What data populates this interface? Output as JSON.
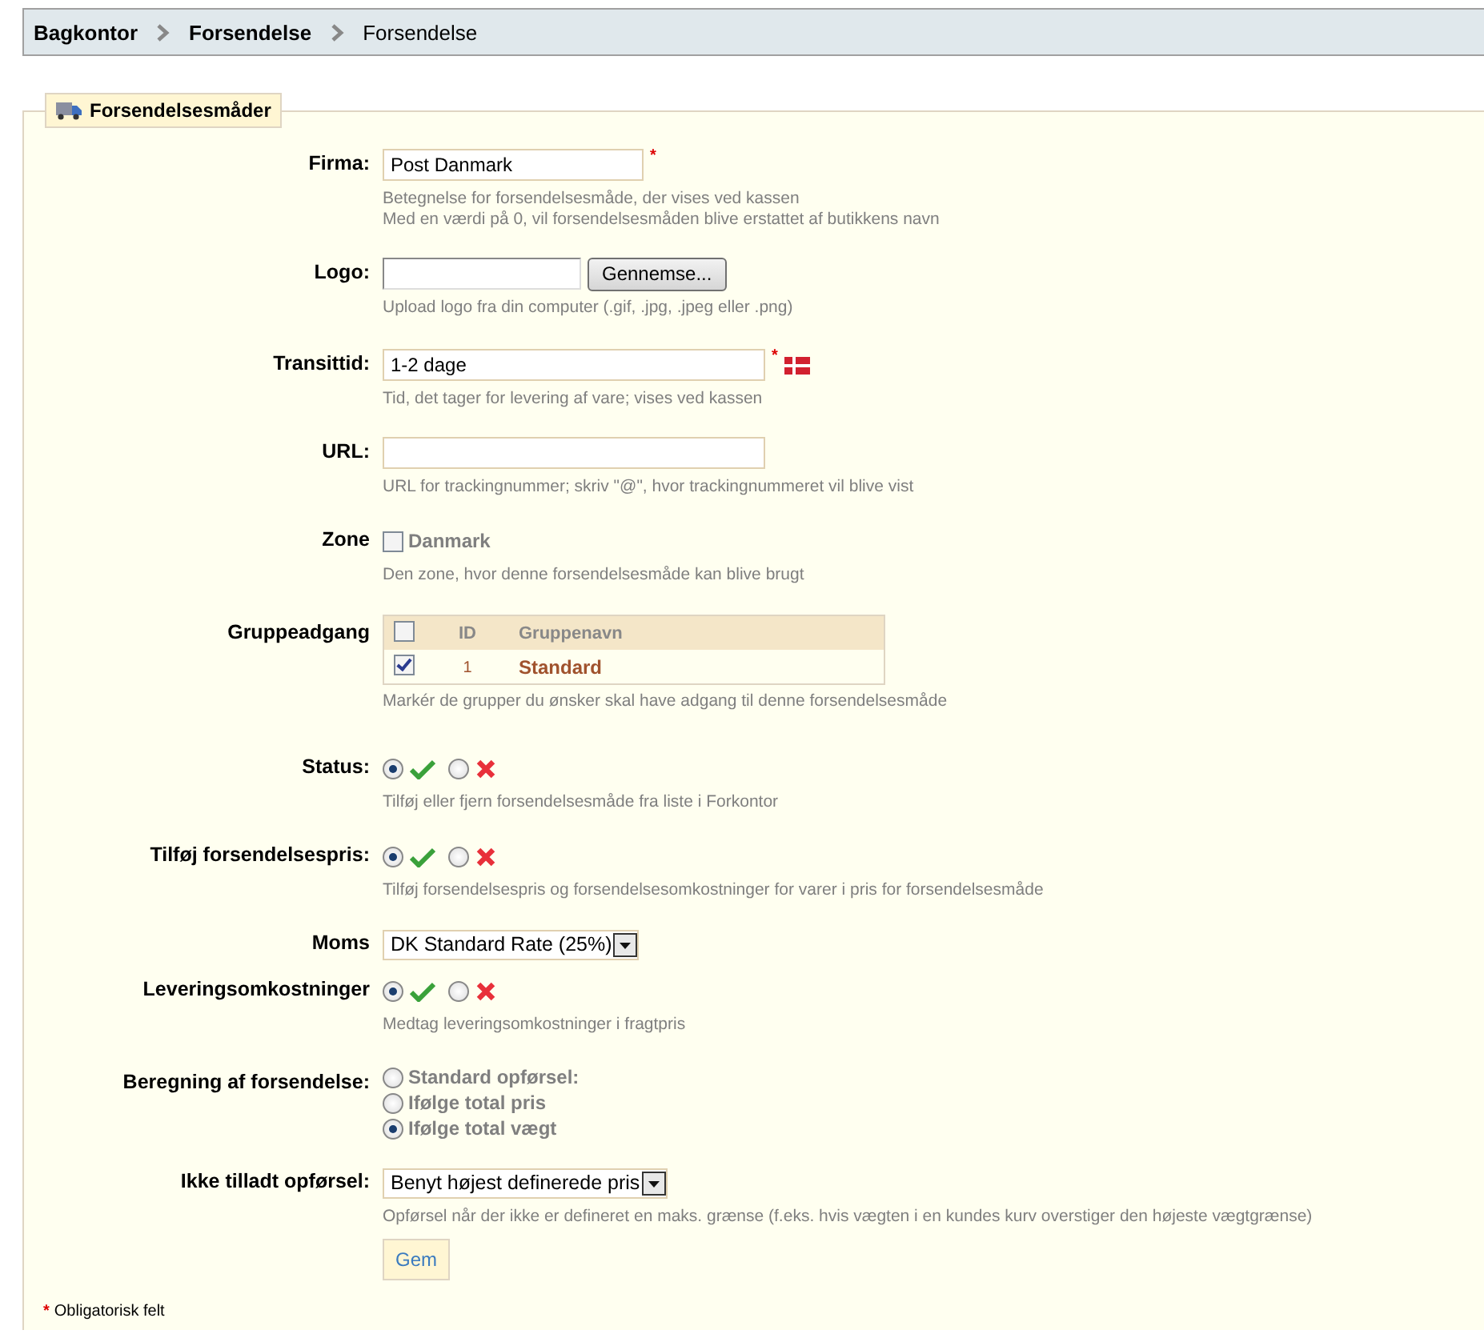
{
  "breadcrumb": [
    {
      "label": "Bagkontor",
      "current": false
    },
    {
      "label": "Forsendelse",
      "current": false
    },
    {
      "label": "Forsendelse",
      "current": true
    }
  ],
  "fieldset": {
    "legend": "Forsendelsesmåder"
  },
  "rows": [
    {
      "kind": "text",
      "label": "Firma:",
      "value": "Post Danmark",
      "wide": false,
      "required": true,
      "flag": false,
      "hints": [
        "Betegnelse for forsendelsesmåde, der vises ved kassen",
        "Med en værdi på 0, vil forsendelsesmåden blive erstattet af butikkens navn"
      ]
    },
    {
      "kind": "file",
      "label": "Logo:",
      "button": "Gennemse...",
      "hints": [
        "Upload logo fra din computer (.gif, .jpg, .jpeg eller .png)"
      ]
    },
    {
      "kind": "text",
      "label": "Transittid:",
      "value": "1-2 dage",
      "wide": true,
      "required": true,
      "flag": true,
      "hints": [
        "Tid, det tager for levering af vare; vises ved kassen"
      ]
    },
    {
      "kind": "text",
      "label": "URL:",
      "wide": true,
      "required": false,
      "flag": false,
      "hints": [
        "URL for trackingnummer; skriv \"@\", hvor trackingnummeret vil blive vist"
      ]
    },
    {
      "kind": "checks",
      "label": "Zone",
      "options": [
        {
          "label": "Danmark",
          "checked": false
        }
      ],
      "hints": [
        "Den zone, hvor denne forsendelsesmåde kan blive brugt"
      ]
    },
    {
      "kind": "groups",
      "label": "Gruppeadgang",
      "columns": [
        "ID",
        "Gruppenavn"
      ],
      "all_checked": false,
      "groups": [
        {
          "id": "1",
          "name": "Standard",
          "checked": true
        }
      ],
      "hints": [
        "Markér de grupper du ønsker skal have adgang til denne forsendelsesmåde"
      ]
    },
    {
      "kind": "toggle",
      "label": "Status:",
      "on": true,
      "hints": [
        "Tilføj eller fjern forsendelsesmåde fra liste i Forkontor"
      ]
    },
    {
      "kind": "toggle",
      "label": "Tilføj forsendelsespris:",
      "on": true,
      "hints": [
        "Tilføj forsendelsespris og forsendelsesomkostninger for varer i pris for forsendelsesmåde"
      ]
    },
    {
      "kind": "select",
      "label": "Moms",
      "value": "DK Standard Rate (25%)"
    },
    {
      "kind": "toggle",
      "label": "Leveringsomkostninger",
      "on": true,
      "hints": [
        "Medtag leveringsomkostninger i fragtpris"
      ]
    },
    {
      "kind": "radios",
      "label": "Beregning af forsendelse:",
      "options": [
        {
          "label": "Standard opførsel:",
          "selected": false
        },
        {
          "label": "Ifølge total pris",
          "selected": false
        },
        {
          "label": "Ifølge total vægt",
          "selected": true
        }
      ]
    },
    {
      "kind": "select",
      "label": "Ikke tilladt opførsel:",
      "value": "Benyt højest definerede pris",
      "hints": [
        "Opførsel når der ikke er defineret en maks. grænse (f.eks. hvis vægten i en kundes kurv overstiger den højeste vægtgrænse)"
      ]
    }
  ],
  "save_button": "Gem",
  "footnote": {
    "mark": "*",
    "text": "Obligatorisk felt"
  }
}
